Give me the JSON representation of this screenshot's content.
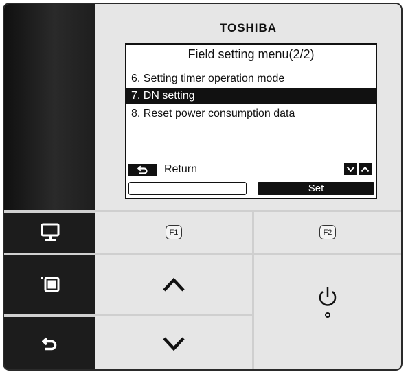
{
  "device": {
    "brand": "TOSHIBA"
  },
  "screen": {
    "title": "Field setting menu(2/2)",
    "items": [
      {
        "label": "6. Setting timer operation mode",
        "selected": false
      },
      {
        "label": "7. DN setting",
        "selected": true
      },
      {
        "label": "8. Reset power consumption data",
        "selected": false
      }
    ],
    "return_label": "Return",
    "f1_label": "",
    "f2_label": "Set"
  },
  "buttons": {
    "f1": "F1",
    "f2": "F2"
  },
  "icons": {
    "menu": "monitor-icon",
    "window": "window-icon",
    "back": "return-arrow-icon",
    "up": "chevron-up-icon",
    "down": "chevron-down-icon",
    "power": "power-icon"
  },
  "colors": {
    "strip": "#1c1c1c",
    "face": "#e6e6e6",
    "lcd_bg": "#ffffff",
    "highlight": "#111111"
  }
}
